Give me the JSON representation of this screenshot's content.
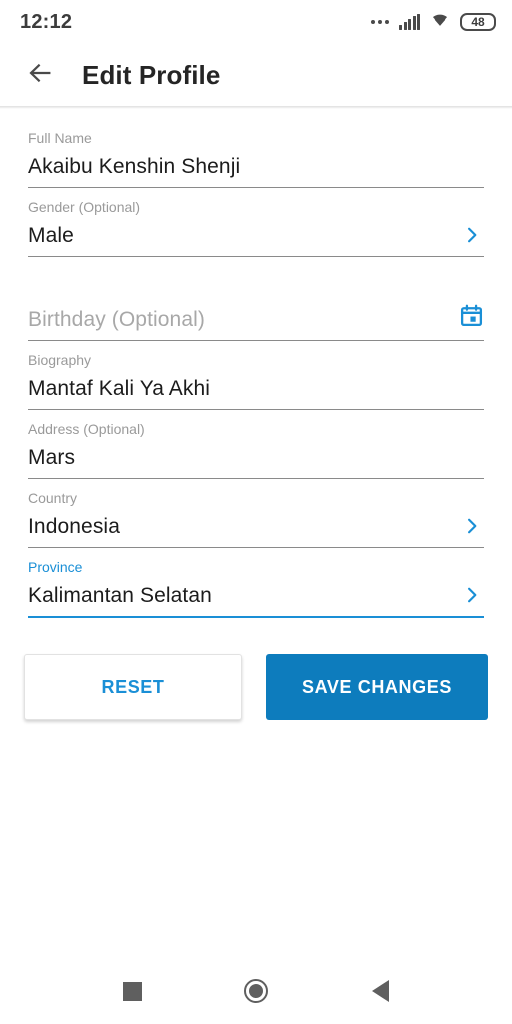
{
  "status_bar": {
    "time": "12:12",
    "battery_level": "48",
    "icons": [
      "more-dots-icon",
      "cellular-signal-icon",
      "wifi-icon",
      "battery-icon"
    ]
  },
  "app_bar": {
    "back_icon": "arrow-left-icon",
    "title": "Edit Profile"
  },
  "colors": {
    "accent": "#1a8fd6",
    "primary_button": "#0d7cbd",
    "label": "#9a9a9a",
    "value": "#1c1c1c",
    "underline": "#8a8a8a"
  },
  "form": {
    "fields": [
      {
        "name": "full-name",
        "label": "Full Name",
        "value": "Akaibu Kenshin Shenji",
        "placeholder": "Full Name",
        "focused": false,
        "trailing_icon": null
      },
      {
        "name": "gender",
        "label": "Gender (Optional)",
        "value": "Male",
        "placeholder": "Gender (Optional)",
        "focused": false,
        "trailing_icon": "chevron-right-icon"
      },
      {
        "name": "birthday",
        "label": "",
        "value": "",
        "placeholder": "Birthday (Optional)",
        "focused": false,
        "trailing_icon": "calendar-icon"
      },
      {
        "name": "biography",
        "label": "Biography",
        "value": "Mantaf Kali Ya Akhi",
        "placeholder": "Biography",
        "focused": false,
        "trailing_icon": null
      },
      {
        "name": "address",
        "label": "Address (Optional)",
        "value": "Mars",
        "placeholder": "Address (Optional)",
        "focused": false,
        "trailing_icon": null
      },
      {
        "name": "country",
        "label": "Country",
        "value": "Indonesia",
        "placeholder": "Country",
        "focused": false,
        "trailing_icon": "chevron-right-icon"
      },
      {
        "name": "province",
        "label": "Province",
        "value": "Kalimantan Selatan",
        "placeholder": "Province",
        "focused": true,
        "trailing_icon": "chevron-right-icon"
      }
    ]
  },
  "actions": {
    "reset_label": "RESET",
    "save_label": "SAVE CHANGES"
  },
  "nav_bar": {
    "recents": "square-recents-icon",
    "home": "circle-home-icon",
    "back": "triangle-back-icon"
  }
}
